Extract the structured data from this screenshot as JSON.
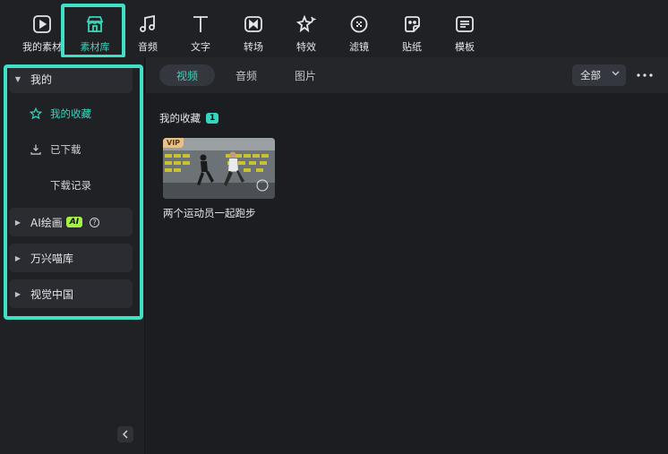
{
  "toolbar": {
    "items": [
      {
        "label": "我的素材",
        "icon": "play-square-icon"
      },
      {
        "label": "素材库",
        "icon": "store-icon"
      },
      {
        "label": "音频",
        "icon": "music-note-icon"
      },
      {
        "label": "文字",
        "icon": "text-t-icon"
      },
      {
        "label": "转场",
        "icon": "transition-icon"
      },
      {
        "label": "特效",
        "icon": "effects-sparkle-icon"
      },
      {
        "label": "滤镜",
        "icon": "filter-icon"
      },
      {
        "label": "贴纸",
        "icon": "sticker-icon"
      },
      {
        "label": "模板",
        "icon": "template-icon"
      }
    ],
    "active_index": 1
  },
  "sidebar": {
    "my_group": "我的",
    "favorites": "我的收藏",
    "downloaded": "已下载",
    "download_history": "下载记录",
    "ai_painting": "AI绘画",
    "ai_badge": "AI",
    "help": "?",
    "wanxing": "万兴喵库",
    "vcg": "视觉中国"
  },
  "tabs": [
    "视频",
    "音频",
    "图片"
  ],
  "filter": {
    "value": "全部"
  },
  "content": {
    "section_title": "我的收藏",
    "count": "1",
    "card_badge": "VIP",
    "card_title": "两个运动员一起跑步"
  },
  "colors": {
    "accent": "#36d6be",
    "highlight": "#3fe0c4",
    "ai_badge": "#a3f244",
    "vip": "#e8c28d"
  }
}
